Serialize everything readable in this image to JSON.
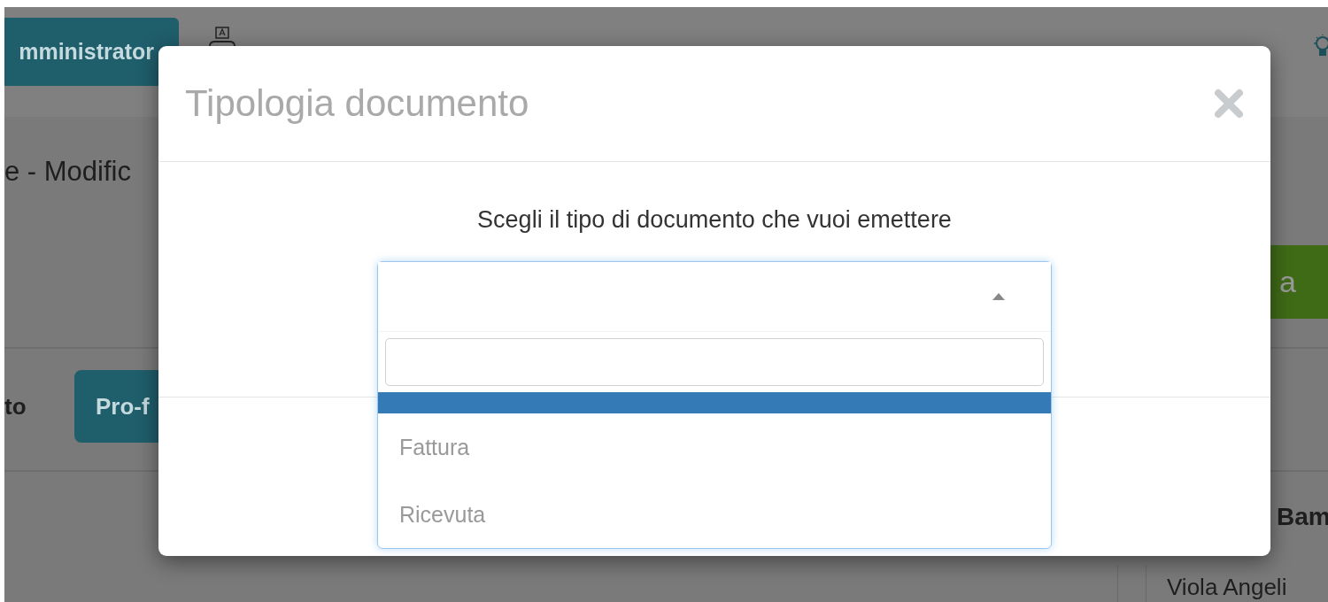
{
  "background": {
    "role_button": "mministrator",
    "page_title": "e - Modific",
    "field_label": "to",
    "proforma_button": "Pro-f",
    "action_button": "a",
    "column_heading": "Bam",
    "table_cell": "Viola Angeli"
  },
  "modal": {
    "title": "Tipologia documento",
    "prompt": "Scegli il tipo di documento che vuoi emettere",
    "select": {
      "expanded": true,
      "options": [
        {
          "kind": "blank",
          "selected": true
        },
        {
          "kind": "text",
          "label": "Fattura",
          "selected": false
        },
        {
          "kind": "text",
          "label": "Ricevuta",
          "selected": false
        }
      ]
    }
  }
}
